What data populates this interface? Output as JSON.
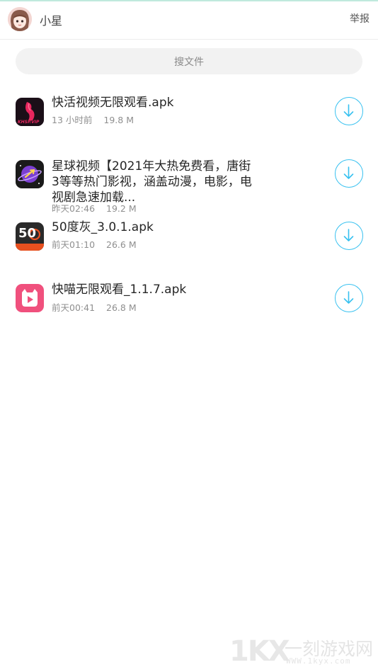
{
  "header": {
    "username": "小星",
    "report_label": "举报",
    "avatar_icon": "anime-girl-avatar"
  },
  "search": {
    "placeholder": "搜文件"
  },
  "files": [
    {
      "name": "快活视频无限观看.apk",
      "time": "13 小时前",
      "size": "19.8 M",
      "icon": "khsp-app-icon",
      "icon_text": "KHSP.VIP"
    },
    {
      "name": "星球视频【2021年大热免费看，唐街3等等热门影视，涵盖动漫，电影，电视剧急速加载...",
      "time": "昨天02:46",
      "size": "19.2 M",
      "icon": "planet-app-icon"
    },
    {
      "name": "50度灰_3.0.1.apk",
      "time": "前天01:10",
      "size": "26.6 M",
      "icon": "fifty-app-icon",
      "icon_text": "50"
    },
    {
      "name": "快喵无限观看_1.1.7.apk",
      "time": "前天00:41",
      "size": "26.8 M",
      "icon": "cat-app-icon"
    }
  ],
  "download_icon": "download-arrow-icon",
  "colors": {
    "accent": "#38c1f0",
    "divider": "#ececec"
  },
  "watermark": {
    "big": "1KX",
    "cn": "一刻游戏网",
    "url": "WWW.1kyx.com"
  }
}
